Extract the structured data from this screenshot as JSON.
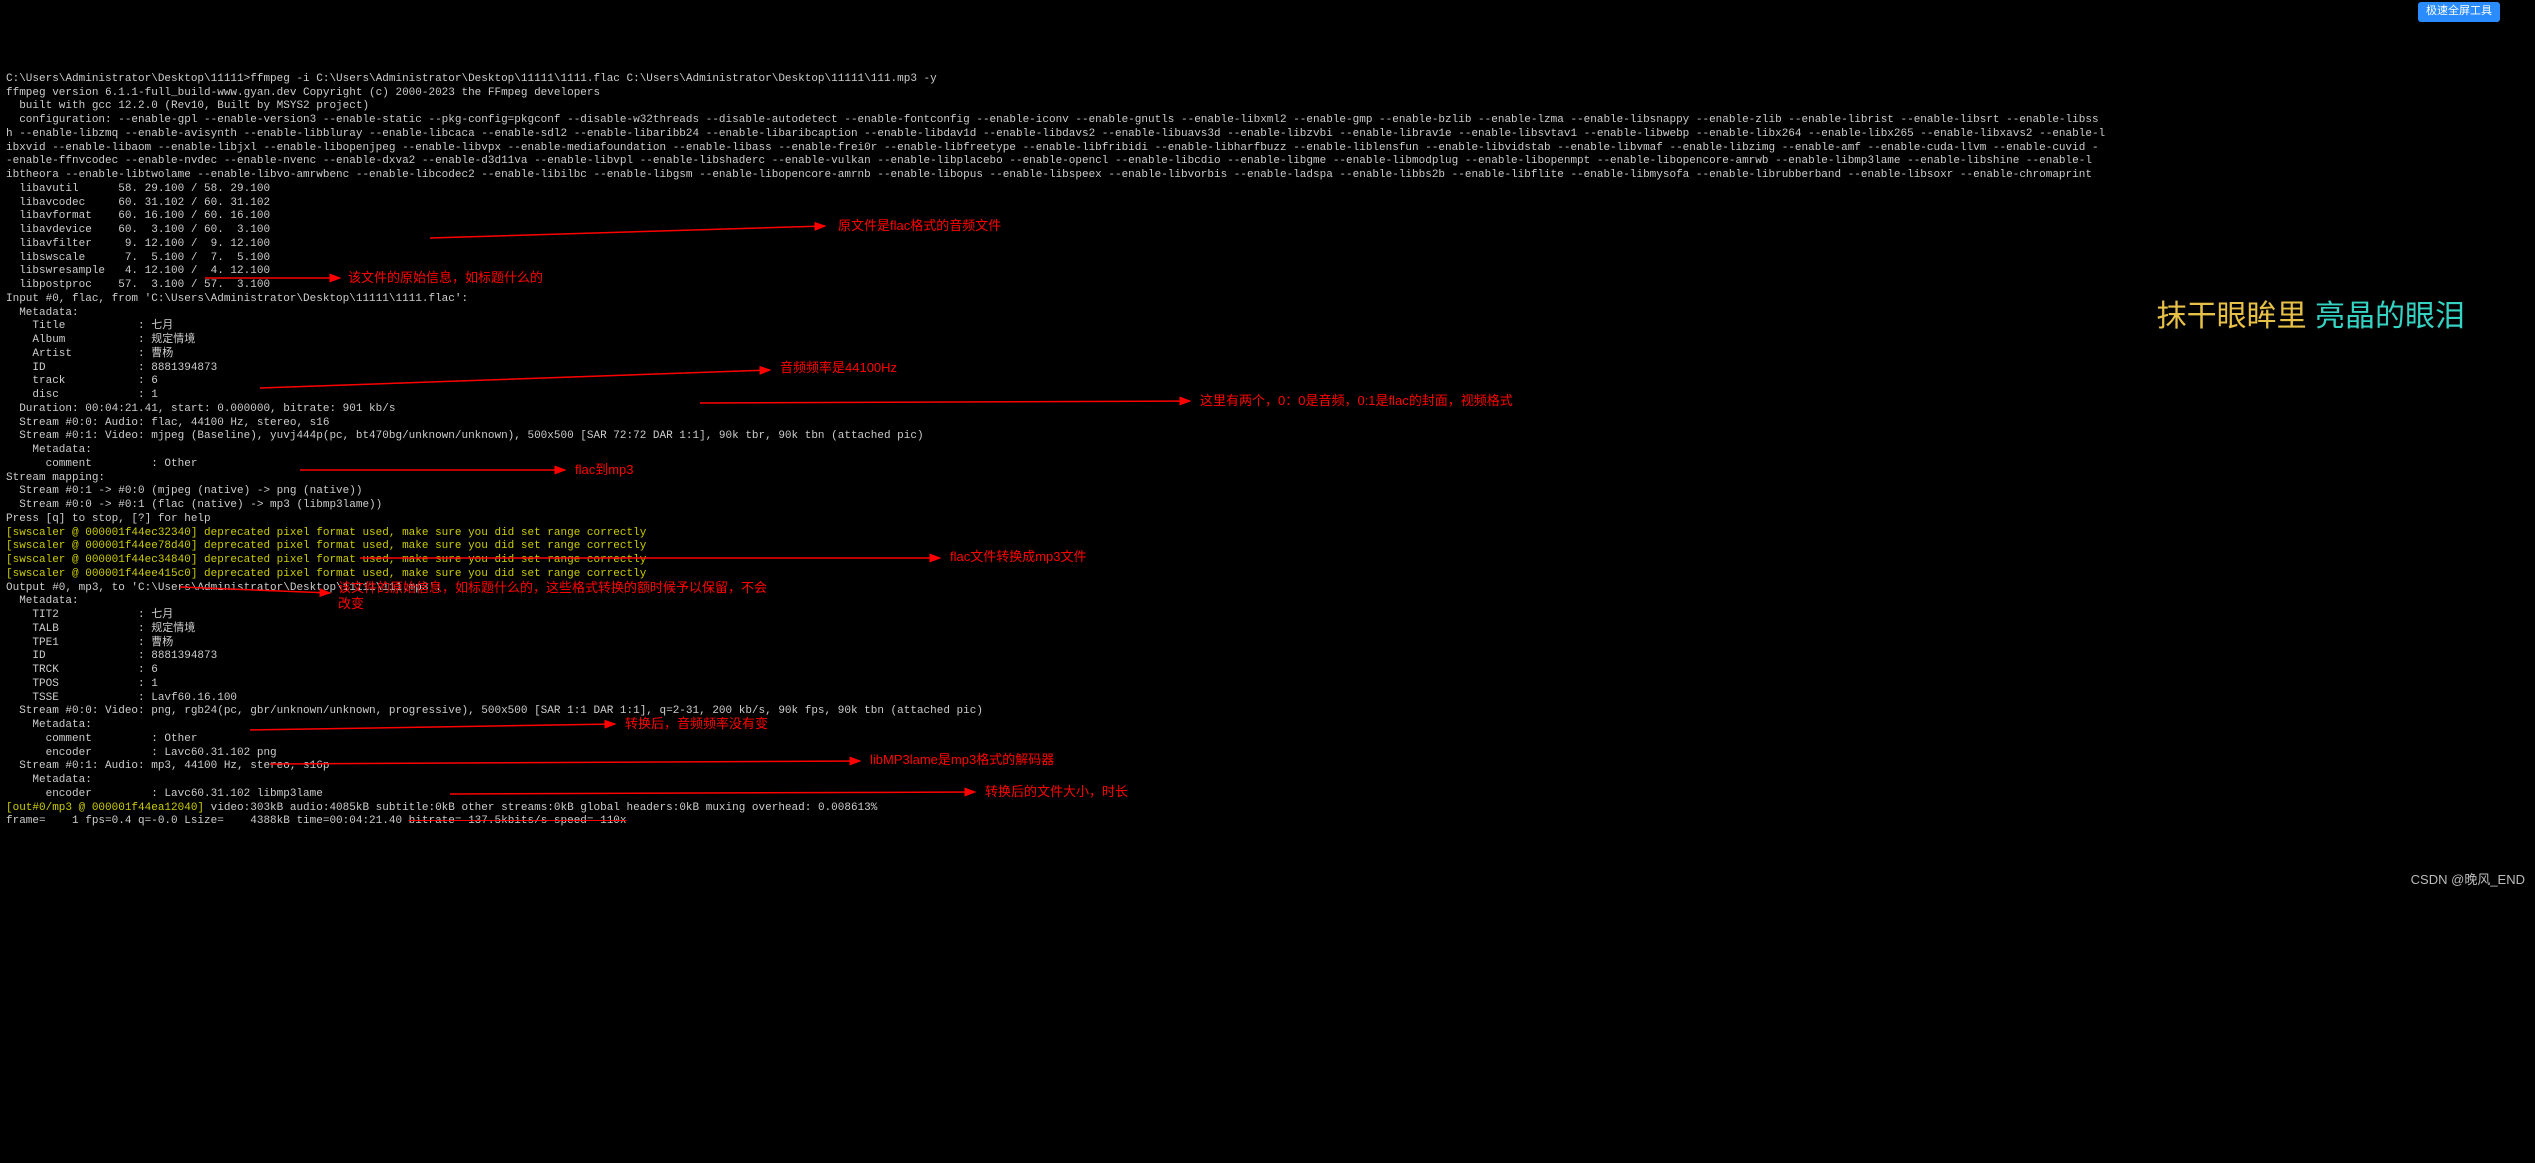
{
  "command": "C:\\Users\\Administrator\\Desktop\\11111>ffmpeg -i C:\\Users\\Administrator\\Desktop\\11111\\1111.flac C:\\Users\\Administrator\\Desktop\\11111\\111.mp3 -y",
  "version": "ffmpeg version 6.1.1-full_build-www.gyan.dev Copyright (c) 2000-2023 the FFmpeg developers",
  "built": "  built with gcc 12.2.0 (Rev10, Built by MSYS2 project)",
  "config_l1": "  configuration: --enable-gpl --enable-version3 --enable-static --pkg-config=pkgconf --disable-w32threads --disable-autodetect --enable-fontconfig --enable-iconv --enable-gnutls --enable-libxml2 --enable-gmp --enable-bzlib --enable-lzma --enable-libsnappy --enable-zlib --enable-librist --enable-libsrt --enable-libss",
  "config_l2": "h --enable-libzmq --enable-avisynth --enable-libbluray --enable-libcaca --enable-sdl2 --enable-libaribb24 --enable-libaribcaption --enable-libdav1d --enable-libdavs2 --enable-libuavs3d --enable-libzvbi --enable-librav1e --enable-libsvtav1 --enable-libwebp --enable-libx264 --enable-libx265 --enable-libxavs2 --enable-l",
  "config_l3": "ibxvid --enable-libaom --enable-libjxl --enable-libopenjpeg --enable-libvpx --enable-mediafoundation --enable-libass --enable-frei0r --enable-libfreetype --enable-libfribidi --enable-libharfbuzz --enable-liblensfun --enable-libvidstab --enable-libvmaf --enable-libzimg --enable-amf --enable-cuda-llvm --enable-cuvid -",
  "config_l4": "-enable-ffnvcodec --enable-nvdec --enable-nvenc --enable-dxva2 --enable-d3d11va --enable-libvpl --enable-libshaderc --enable-vulkan --enable-libplacebo --enable-opencl --enable-libcdio --enable-libgme --enable-libmodplug --enable-libopenmpt --enable-libopencore-amrwb --enable-libmp3lame --enable-libshine --enable-l",
  "config_l5": "ibtheora --enable-libtwolame --enable-libvo-amrwbenc --enable-libcodec2 --enable-libilbc --enable-libgsm --enable-libopencore-amrnb --enable-libopus --enable-libspeex --enable-libvorbis --enable-ladspa --enable-libbs2b --enable-libflite --enable-libmysofa --enable-librubberband --enable-libsoxr --enable-chromaprint",
  "libs": [
    "  libavutil      58. 29.100 / 58. 29.100",
    "  libavcodec     60. 31.102 / 60. 31.102",
    "  libavformat    60. 16.100 / 60. 16.100",
    "  libavdevice    60.  3.100 / 60.  3.100",
    "  libavfilter     9. 12.100 /  9. 12.100",
    "  libswscale      7.  5.100 /  7.  5.100",
    "  libswresample   4. 12.100 /  4. 12.100",
    "  libpostproc    57.  3.100 / 57.  3.100"
  ],
  "input_header": "Input #0, flac, from 'C:\\Users\\Administrator\\Desktop\\11111\\1111.flac':",
  "metadata_label": "  Metadata:",
  "meta_lines": [
    "    Title           : 七月",
    "    Album           : 规定情境",
    "    Artist          : 曹杨",
    "    ID              : 8881394873",
    "    track           : 6",
    "    disc            : 1"
  ],
  "duration": "  Duration: 00:04:21.41, start: 0.000000, bitrate: 901 kb/s",
  "stream_audio": "  Stream #0:0: Audio: flac, 44100 Hz, stereo, s16",
  "stream_video": "  Stream #0:1: Video: mjpeg (Baseline), yuvj444p(pc, bt470bg/unknown/unknown), 500x500 [SAR 72:72 DAR 1:1], 90k tbr, 90k tbn (attached pic)",
  "meta2": "    Metadata:",
  "comment": "      comment         : Other",
  "stream_mapping": "Stream mapping:",
  "map1": "  Stream #0:1 -> #0:0 (mjpeg (native) -> png (native))",
  "map2": "  Stream #0:0 -> #0:1 (flac (native) -> mp3 (libmp3lame))",
  "press": "Press [q] to stop, [?] for help",
  "sws1": "[swscaler @ 000001f44ec32340] deprecated pixel format used, make sure you did set range correctly",
  "sws2": "[swscaler @ 000001f44ee78d40] deprecated pixel format used, make sure you did set range correctly",
  "sws3": "[swscaler @ 000001f44ec34840] deprecated pixel format used, make sure you did set range correctly",
  "sws4": "[swscaler @ 000001f44ee415c0] deprecated pixel format used, make sure you did set range correctly",
  "output_header": "Output #0, mp3, to 'C:\\Users\\Administrator\\Desktop\\11111\\111.mp3':",
  "out_meta": [
    "  Metadata:",
    "    TIT2            : 七月",
    "    TALB            : 规定情境",
    "    TPE1            : 曹杨",
    "    ID              : 8881394873",
    "    TRCK            : 6",
    "    TPOS            : 1",
    "    TSSE            : Lavf60.16.100"
  ],
  "out_stream0": "  Stream #0:0: Video: png, rgb24(pc, gbr/unknown/unknown, progressive), 500x500 [SAR 1:1 DAR 1:1], q=2-31, 200 kb/s, 90k fps, 90k tbn (attached pic)",
  "out_stream0_meta": [
    "    Metadata:",
    "      comment         : Other",
    "      encoder         : Lavc60.31.102 png"
  ],
  "out_stream1": "  Stream #0:1: Audio: mp3, 44100 Hz, stereo, s16p",
  "out_stream1_meta": [
    "    Metadata:",
    "      encoder         : Lavc60.31.102 libmp3lame"
  ],
  "summary_yellow": "[out#0/mp3 @ 000001f44ea12040] ",
  "summary_rest": "video:303kB audio:4085kB subtitle:0kB other streams:0kB global headers:0kB muxing overhead: 0.008613%",
  "frame": "frame=    1 fps=0.4 q=-0.0 Lsize=    4388kB time=00:04:21.40 ",
  "bitrate_struck": "bitrate= 137.5kbits/s speed= 110x",
  "annotations": {
    "a1": "原文件是flac格式的音频文件",
    "a2": "该文件的原始信息，如标题什么的",
    "a3": "音频频率是44100Hz",
    "a4": "这里有两个，0：0是音频，0:1是flac的封面，视频格式",
    "a5": "flac到mp3",
    "a6": "flac文件转换成mp3文件",
    "a7": "该文件的原始信息，如标题什么的，这些格式转换的额时候予以保留，不会改变",
    "a8": "转换后，音频频率没有变",
    "a9": "libMP3lame是mp3格式的解码器",
    "a10": "转换后的文件大小，时长"
  },
  "big_text": {
    "part1": "抹干眼眸里 ",
    "part2": "亮晶的眼泪"
  },
  "watermark": "CSDN @晚风_END",
  "button_top": "极速全屏工具"
}
